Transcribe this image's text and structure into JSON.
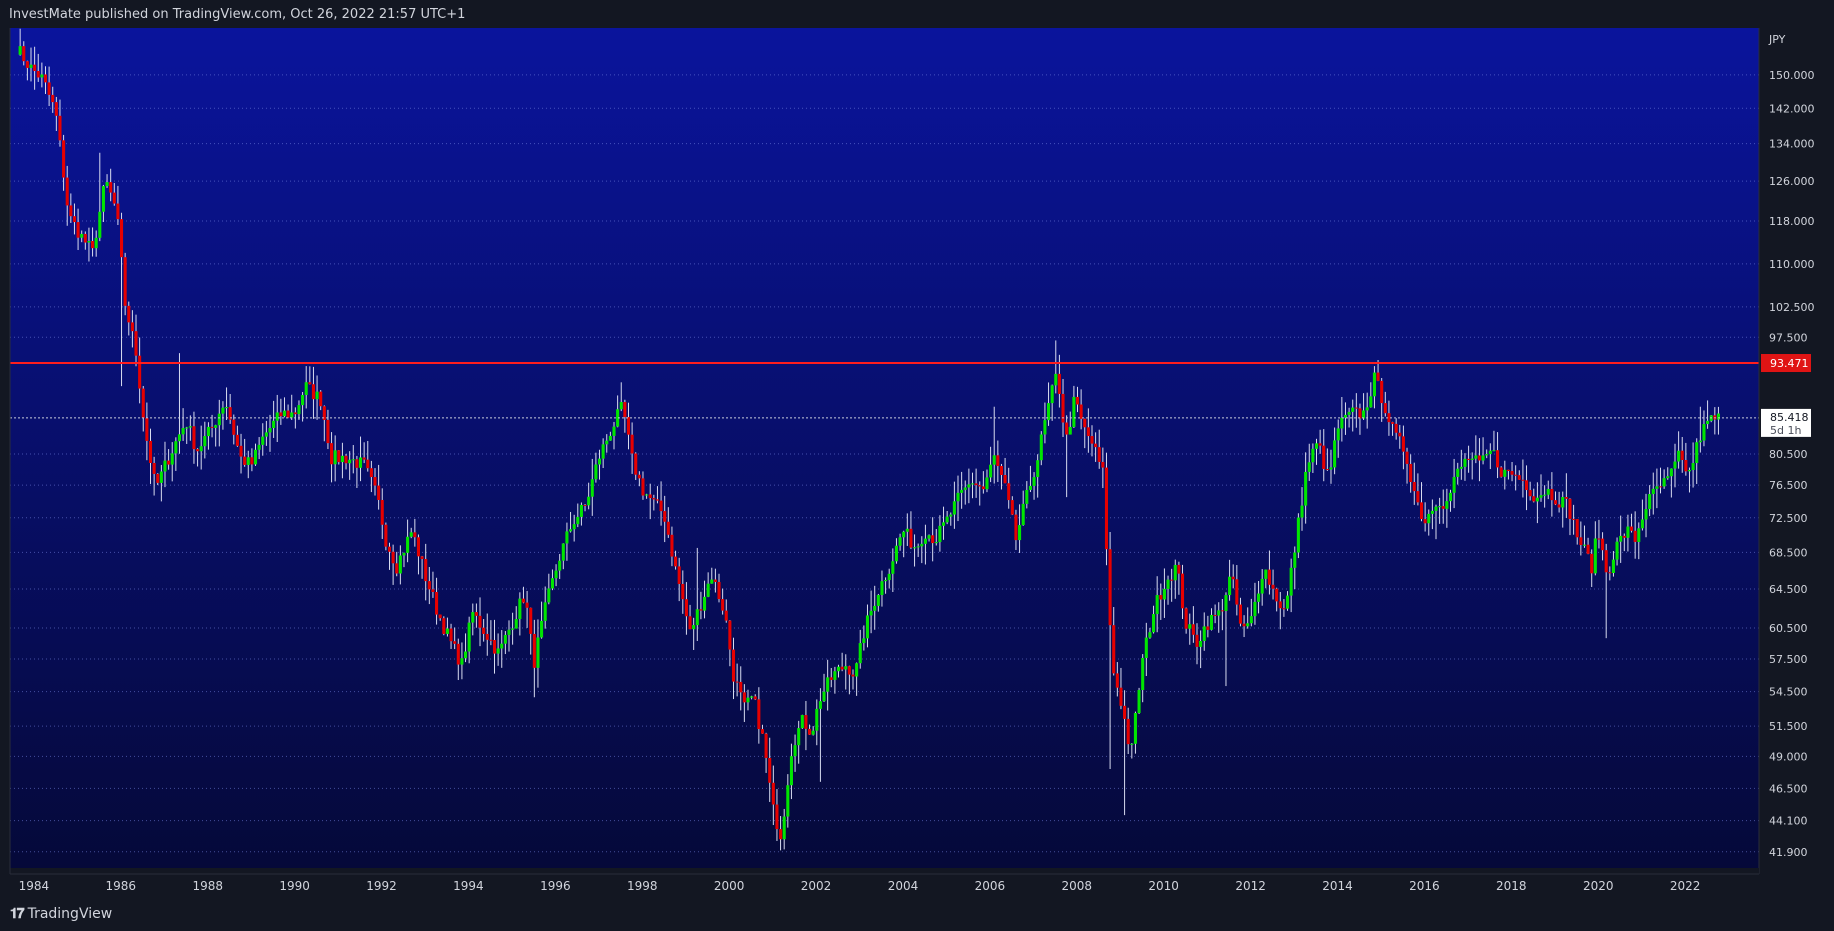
{
  "header": {
    "attribution": "InvestMate published on TradingView.com, Oct 26, 2022 21:57 UTC+1"
  },
  "footer": {
    "logo_text": "TradingView"
  },
  "colors": {
    "background_top": "#0a149c",
    "background_bottom": "#050939",
    "up": "#00e600",
    "down": "#e60000",
    "wick": "#d8dcf0",
    "resistance": "#ff1e1e",
    "axis_text": "#d1d4dc"
  },
  "chart_data": {
    "type": "candlestick",
    "title": "",
    "currency": "JPY",
    "y_scale": "log",
    "ylim": [
      40.8,
      162
    ],
    "xlim": [
      1983.45,
      2023.7
    ],
    "y_ticks": [
      "150.000",
      "142.000",
      "134.000",
      "126.000",
      "118.000",
      "110.000",
      "102.500",
      "97.500",
      "80.500",
      "76.500",
      "72.500",
      "68.500",
      "64.500",
      "60.500",
      "57.500",
      "54.500",
      "51.500",
      "49.000",
      "46.500",
      "44.100",
      "41.900"
    ],
    "x_ticks": [
      "1984",
      "1986",
      "1988",
      "1990",
      "1992",
      "1994",
      "1996",
      "1998",
      "2000",
      "2002",
      "2004",
      "2006",
      "2008",
      "2010",
      "2012",
      "2014",
      "2016",
      "2018",
      "2020",
      "2022"
    ],
    "resistance_level": {
      "value": 93.471,
      "label": "93.471"
    },
    "last_price": {
      "value": 85.418,
      "label": "85.418",
      "countdown": "5d 1h"
    },
    "anchors": [
      [
        1983.6,
        157
      ],
      [
        1983.9,
        152
      ],
      [
        1984.2,
        149
      ],
      [
        1984.5,
        141
      ],
      [
        1984.8,
        119
      ],
      [
        1985.1,
        115
      ],
      [
        1985.35,
        112
      ],
      [
        1985.65,
        126
      ],
      [
        1985.9,
        120
      ],
      [
        1986.1,
        103
      ],
      [
        1986.35,
        95
      ],
      [
        1986.55,
        84
      ],
      [
        1986.8,
        76
      ],
      [
        1987.1,
        80
      ],
      [
        1987.5,
        85
      ],
      [
        1987.75,
        81
      ],
      [
        1988.1,
        84
      ],
      [
        1988.4,
        88
      ],
      [
        1988.75,
        80
      ],
      [
        1989.0,
        79
      ],
      [
        1989.3,
        83
      ],
      [
        1989.7,
        86
      ],
      [
        1990.0,
        86
      ],
      [
        1990.25,
        90
      ],
      [
        1990.6,
        88
      ],
      [
        1990.85,
        80
      ],
      [
        1991.2,
        80
      ],
      [
        1991.6,
        79
      ],
      [
        1991.9,
        75
      ],
      [
        1992.1,
        70
      ],
      [
        1992.35,
        67
      ],
      [
        1992.7,
        71
      ],
      [
        1993.0,
        66
      ],
      [
        1993.3,
        62
      ],
      [
        1993.6,
        59
      ],
      [
        1993.85,
        57
      ],
      [
        1994.1,
        62
      ],
      [
        1994.4,
        60
      ],
      [
        1994.7,
        58
      ],
      [
        1995.0,
        61
      ],
      [
        1995.3,
        64
      ],
      [
        1995.5,
        57
      ],
      [
        1995.8,
        63
      ],
      [
        1996.1,
        68
      ],
      [
        1996.4,
        72
      ],
      [
        1996.7,
        74
      ],
      [
        1997.0,
        80
      ],
      [
        1997.3,
        84
      ],
      [
        1997.55,
        87
      ],
      [
        1997.75,
        80
      ],
      [
        1998.0,
        76
      ],
      [
        1998.3,
        74
      ],
      [
        1998.5,
        73
      ],
      [
        1998.75,
        67
      ],
      [
        1999.1,
        60
      ],
      [
        1999.35,
        63
      ],
      [
        1999.6,
        66
      ],
      [
        1999.9,
        62
      ],
      [
        2000.1,
        56
      ],
      [
        2000.35,
        53
      ],
      [
        2000.55,
        54
      ],
      [
        2000.8,
        50
      ],
      [
        2001.0,
        45
      ],
      [
        2001.2,
        43
      ],
      [
        2001.45,
        50
      ],
      [
        2001.7,
        52
      ],
      [
        2001.9,
        51
      ],
      [
        2002.1,
        54
      ],
      [
        2002.4,
        56
      ],
      [
        2002.7,
        57
      ],
      [
        2002.9,
        56
      ],
      [
        2003.1,
        60
      ],
      [
        2003.4,
        64
      ],
      [
        2003.7,
        67
      ],
      [
        2004.0,
        71
      ],
      [
        2004.3,
        69
      ],
      [
        2004.5,
        71
      ],
      [
        2004.75,
        70
      ],
      [
        2005.0,
        72
      ],
      [
        2005.3,
        75
      ],
      [
        2005.6,
        77
      ],
      [
        2005.85,
        76
      ],
      [
        2006.1,
        80
      ],
      [
        2006.35,
        76
      ],
      [
        2006.6,
        70
      ],
      [
        2006.85,
        75
      ],
      [
        2007.1,
        80
      ],
      [
        2007.35,
        87
      ],
      [
        2007.55,
        92
      ],
      [
        2007.75,
        82
      ],
      [
        2007.95,
        88
      ],
      [
        2008.15,
        84
      ],
      [
        2008.35,
        82
      ],
      [
        2008.6,
        78
      ],
      [
        2008.8,
        57
      ],
      [
        2009.0,
        54
      ],
      [
        2009.25,
        49
      ],
      [
        2009.5,
        57
      ],
      [
        2009.75,
        62
      ],
      [
        2010.0,
        65
      ],
      [
        2010.3,
        67
      ],
      [
        2010.5,
        61
      ],
      [
        2010.75,
        59
      ],
      [
        2011.0,
        61
      ],
      [
        2011.3,
        62
      ],
      [
        2011.55,
        66
      ],
      [
        2011.8,
        60
      ],
      [
        2012.0,
        61
      ],
      [
        2012.3,
        67
      ],
      [
        2012.55,
        64
      ],
      [
        2012.8,
        62
      ],
      [
        2013.05,
        70
      ],
      [
        2013.3,
        79
      ],
      [
        2013.55,
        82
      ],
      [
        2013.8,
        77
      ],
      [
        2014.0,
        84
      ],
      [
        2014.3,
        86
      ],
      [
        2014.6,
        86
      ],
      [
        2014.85,
        91
      ],
      [
        2015.05,
        88
      ],
      [
        2015.3,
        83
      ],
      [
        2015.55,
        81
      ],
      [
        2015.8,
        75
      ],
      [
        2016.0,
        72
      ],
      [
        2016.3,
        75
      ],
      [
        2016.5,
        74
      ],
      [
        2016.75,
        78
      ],
      [
        2017.0,
        80
      ],
      [
        2017.3,
        79
      ],
      [
        2017.55,
        81
      ],
      [
        2017.8,
        78
      ],
      [
        2018.0,
        78
      ],
      [
        2018.3,
        77
      ],
      [
        2018.55,
        75
      ],
      [
        2018.8,
        76
      ],
      [
        2019.0,
        75
      ],
      [
        2019.3,
        74
      ],
      [
        2019.55,
        70
      ],
      [
        2019.85,
        67
      ],
      [
        2020.0,
        71
      ],
      [
        2020.2,
        66
      ],
      [
        2020.4,
        69
      ],
      [
        2020.65,
        71
      ],
      [
        2020.85,
        70
      ],
      [
        2021.1,
        74
      ],
      [
        2021.35,
        76
      ],
      [
        2021.6,
        77
      ],
      [
        2021.85,
        80
      ],
      [
        2022.1,
        78
      ],
      [
        2022.35,
        83
      ],
      [
        2022.55,
        85
      ],
      [
        2022.75,
        85.4
      ]
    ],
    "spikes": [
      [
        1985.55,
        "h",
        132
      ],
      [
        1986.05,
        "l",
        90
      ],
      [
        1987.35,
        "h",
        95
      ],
      [
        1990.3,
        "h",
        93
      ],
      [
        1995.5,
        "l",
        54
      ],
      [
        1999.25,
        "h",
        69
      ],
      [
        2001.2,
        "l",
        42
      ],
      [
        2002.1,
        "l",
        47
      ],
      [
        2006.1,
        "h",
        87
      ],
      [
        2007.55,
        "h",
        97
      ],
      [
        2007.75,
        "l",
        75
      ],
      [
        2008.8,
        "l",
        48
      ],
      [
        2009.1,
        "l",
        44.5
      ],
      [
        2011.45,
        "l",
        55
      ],
      [
        2014.85,
        "h",
        93
      ],
      [
        2016.3,
        "l",
        70
      ],
      [
        2019.3,
        "h",
        78
      ],
      [
        2020.2,
        "l",
        59.5
      ],
      [
        2022.35,
        "h",
        87
      ]
    ]
  }
}
